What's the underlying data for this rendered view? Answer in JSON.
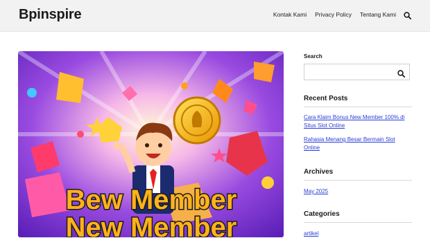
{
  "site": {
    "title": "Bpinspire"
  },
  "nav": {
    "items": [
      "Kontak Kami",
      "Privacy Policy",
      "Tentang Kami"
    ],
    "search_icon": "search-icon"
  },
  "hero": {
    "text_line1": "Bew  Member",
    "text_line2": "New Member",
    "colors": {
      "text_fill": "#ffb21a",
      "text_stroke": "#1a1a1a",
      "burst": "#6a2bd9"
    }
  },
  "sidebar": {
    "search": {
      "label": "Search",
      "placeholder": ""
    },
    "recent_posts": {
      "title": "Recent Posts",
      "items": [
        "Cara Klaim Bonus New Member 100% di Situs Slot Online",
        "Rahasia Menang Besar Bermain Slot Online"
      ]
    },
    "archives": {
      "title": "Archives",
      "items": [
        "May 2025"
      ]
    },
    "categories": {
      "title": "Categories",
      "items": [
        "artikel"
      ]
    }
  },
  "colors": {
    "link": "#2a3dd6",
    "header_bg": "#f2f2f2"
  }
}
